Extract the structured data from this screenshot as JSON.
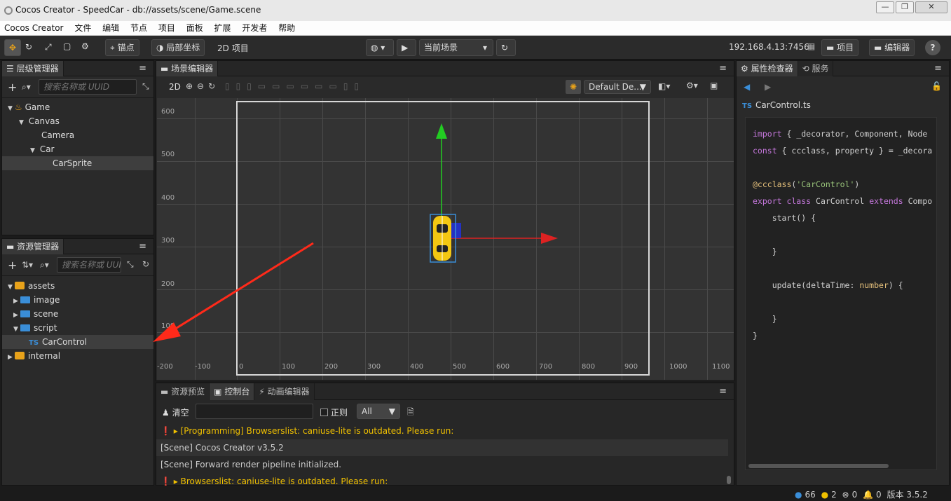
{
  "window": {
    "title": "Cocos Creator - SpeedCar - db://assets/scene/Game.scene"
  },
  "menu": [
    "Cocos Creator",
    "文件",
    "编辑",
    "节点",
    "项目",
    "面板",
    "扩展",
    "开发者",
    "帮助"
  ],
  "toolbar": {
    "anchor": "锚点",
    "local_coord": "局部坐标",
    "mode": "2D 项目",
    "scene_select": "当前场景",
    "ip": "192.168.4.13:7456",
    "project_btn": "项目",
    "editor_btn": "编辑器",
    "help": "?"
  },
  "hierarchy": {
    "tab": "层级管理器",
    "search_placeholder": "搜索名称或 UUID",
    "nodes": [
      {
        "label": "Game"
      },
      {
        "label": "Canvas"
      },
      {
        "label": "Camera"
      },
      {
        "label": "Car"
      },
      {
        "label": "CarSprite"
      }
    ]
  },
  "assets": {
    "tab": "资源管理器",
    "search_placeholder": "搜索名称或 UUID",
    "items": [
      {
        "label": "assets"
      },
      {
        "label": "image"
      },
      {
        "label": "scene"
      },
      {
        "label": "script"
      },
      {
        "label": "CarControl"
      },
      {
        "label": "internal"
      }
    ]
  },
  "scene_editor": {
    "tab": "场景编辑器",
    "mode_2d": "2D",
    "camera_select": "Default De...",
    "x_ticks": [
      "-200",
      "-100",
      "0",
      "100",
      "200",
      "300",
      "400",
      "500",
      "600",
      "700",
      "800",
      "900",
      "1000",
      "1100"
    ],
    "y_ticks": [
      "600",
      "500",
      "400",
      "300",
      "200",
      "100"
    ]
  },
  "bottom": {
    "tabs": [
      "资源预览",
      "控制台",
      "动画编辑器"
    ],
    "clear": "清空",
    "regex": "正则",
    "filter": "All",
    "logs": [
      {
        "text": "[Programming] Browserslist: caniuse-lite is outdated. Please run:",
        "level": "warn"
      },
      {
        "text": "[Scene] Cocos Creator v3.5.2",
        "level": "info"
      },
      {
        "text": "[Scene] Forward render pipeline initialized.",
        "level": "info"
      },
      {
        "text": "Browserslist: caniuse-lite is outdated. Please run:",
        "level": "warn"
      }
    ]
  },
  "inspector": {
    "tabs": [
      "属性检查器",
      "服务"
    ],
    "file_badge": "TS",
    "file": "CarControl.ts",
    "code_lines": [
      "import { _decorator, Component, Node",
      "const { ccclass, property } = _decora",
      "",
      "@ccclass('CarControl')",
      "export class CarControl extends Compo",
      "    start() {",
      "",
      "    }",
      "",
      "    update(deltaTime: number) {",
      "",
      "    }",
      "}"
    ]
  },
  "status": {
    "count_info": "66",
    "warn": "2",
    "error": "0",
    "notice": "0",
    "version": "版本 3.5.2"
  },
  "colors": {
    "accent": "#e8a21a",
    "ts_blue": "#3a8ed8",
    "warn_yellow": "#f0c000",
    "arrow_red": "#ff2a1a"
  }
}
